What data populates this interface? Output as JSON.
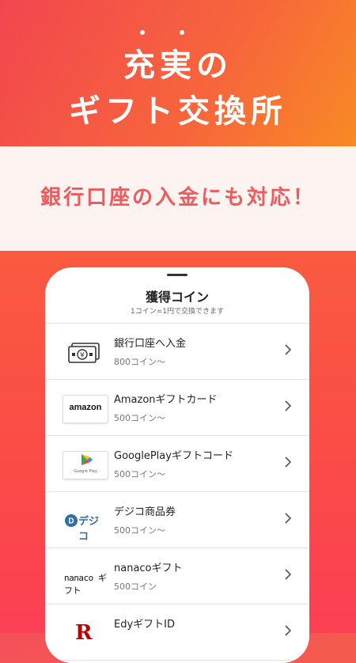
{
  "hero": {
    "line1": "充実の",
    "line2": "ギフト交換所"
  },
  "banner": {
    "text": "銀行口座の入金にも対応！"
  },
  "panel": {
    "title": "獲得コイン",
    "subtitle": "1コイン=1円で交換できます",
    "items": [
      {
        "name": "銀行口座へ入金",
        "coins": "800コイン〜",
        "icon": "bank-transfer-icon"
      },
      {
        "name": "Amazonギフトカード",
        "coins": "500コイン〜",
        "icon": "amazon-logo",
        "logo_text": "amazon"
      },
      {
        "name": "GooglePlayギフトコード",
        "coins": "500コイン〜",
        "icon": "google-play-logo",
        "logo_text": "Google Play"
      },
      {
        "name": "デジコ商品券",
        "coins": "500コイン〜",
        "icon": "dejiko-logo",
        "logo_text": "デジコ"
      },
      {
        "name": "nanacoギフト",
        "coins": "500コイン",
        "icon": "nanaco-logo",
        "logo_text": "nanaco ギフト"
      },
      {
        "name": "EdyギフトID",
        "coins": "",
        "icon": "rakuten-edy-logo",
        "logo_text": "R"
      }
    ]
  },
  "colors": {
    "accent": "#ef5a5d",
    "hero_start": "#f2464f",
    "hero_end": "#f88a24",
    "banner_bg": "#fdf3f1"
  }
}
